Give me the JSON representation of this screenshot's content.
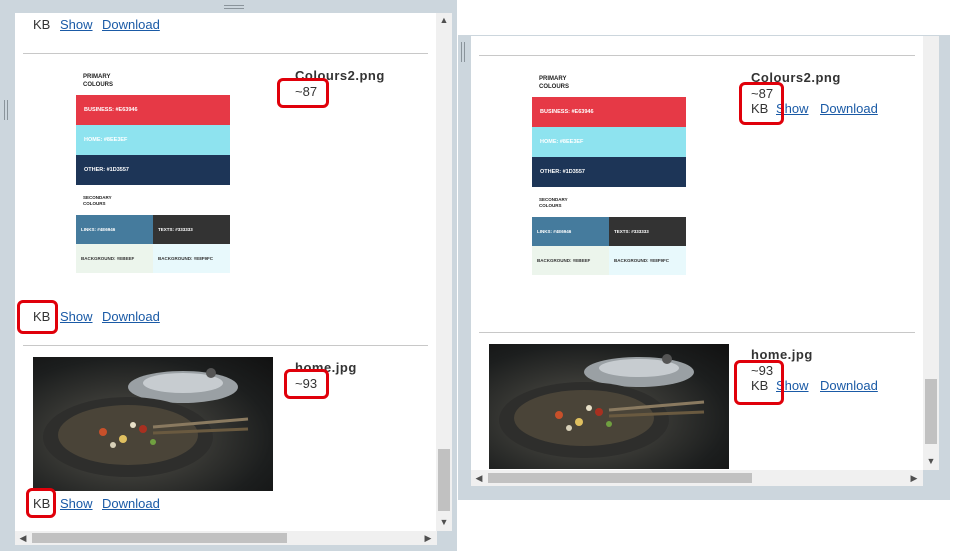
{
  "left_pane": {
    "top_entry": {
      "size_unit": "KB",
      "show_label": "Show",
      "download_label": "Download"
    },
    "colours_entry": {
      "filename": "Colours2.png",
      "size_value": "~87",
      "size_unit": "KB",
      "show_label": "Show",
      "download_label": "Download"
    },
    "home_entry": {
      "filename": "home.jpg",
      "size_value": "~93",
      "size_unit": "KB",
      "show_label": "Show",
      "download_label": "Download"
    }
  },
  "right_pane": {
    "colours_entry": {
      "filename": "Colours2.png",
      "size_value": "~87",
      "size_unit": "KB",
      "show_label": "Show",
      "download_label": "Download"
    },
    "home_entry": {
      "filename": "home.jpg",
      "size_value": "~93",
      "size_unit": "KB",
      "show_label": "Show",
      "download_label": "Download"
    }
  },
  "colour_card": {
    "primary_title_1": "PRIMARY",
    "primary_title_2": "COLOURS",
    "business": "BUSINESS: #E63946",
    "home": "HOME: #8EE3EF",
    "other": "OTHER: #1D3557",
    "secondary_title_1": "SECONDARY",
    "secondary_title_2": "COLOURS",
    "links": "LINKS: #4E6946",
    "texts": "TEXTS: #333333",
    "background1": "BACKGROUND: #EBEEF",
    "background2": "BACKGROUND: #E8F9FC",
    "colors": {
      "business": "#e63946",
      "home": "#8ee3ef",
      "other": "#1d3557",
      "links": "#457b9d",
      "texts": "#333333",
      "background1": "#ecf5ec",
      "background2": "#e8f9fc"
    }
  },
  "annotation_color": "#e0000a",
  "link_color": "#1a5aa6"
}
